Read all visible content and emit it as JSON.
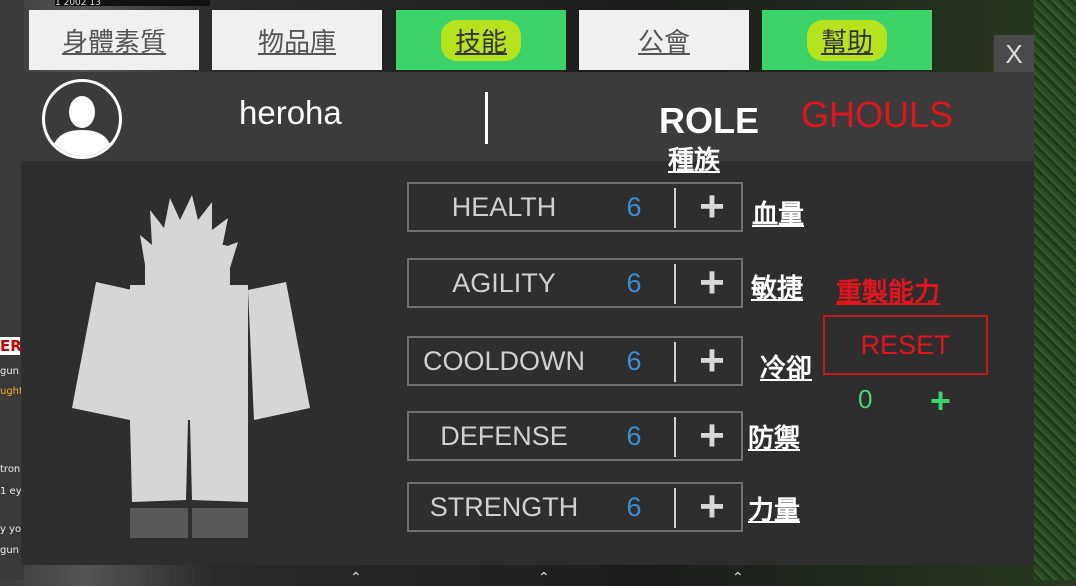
{
  "background": {
    "top_strip": "1 2002  13",
    "chat_lines": [
      "ER",
      "gun",
      "ught",
      "tron",
      "1 ey",
      "y you",
      "gun"
    ]
  },
  "tabs": [
    {
      "label": "身體素質",
      "style": "gray"
    },
    {
      "label": "物品庫",
      "style": "gray"
    },
    {
      "label": "技能",
      "style": "green"
    },
    {
      "label": "公會",
      "style": "gray"
    },
    {
      "label": "幫助",
      "style": "green"
    }
  ],
  "close_label": "X",
  "header": {
    "username": "heroha",
    "role_label": "ROLE",
    "role_value": "GHOULS",
    "role_cn": "種族"
  },
  "stats": [
    {
      "name": "HEALTH",
      "value": "6",
      "cn": "血量"
    },
    {
      "name": "AGILITY",
      "value": "6",
      "cn": "敏捷"
    },
    {
      "name": "COOLDOWN",
      "value": "6",
      "cn": "冷卻"
    },
    {
      "name": "DEFENSE",
      "value": "6",
      "cn": "防禦"
    },
    {
      "name": "STRENGTH",
      "value": "6",
      "cn": "力量"
    }
  ],
  "stat_plus": "+",
  "reset": {
    "cn": "重製能力",
    "label": "RESET",
    "count": "0",
    "plus": "+"
  },
  "colors": {
    "role_value": "#e0141c",
    "stat_value": "#3a8fd6",
    "tab_green": "#3cd46a",
    "reset": "#e0141c",
    "reset_count": "#4fd37a"
  }
}
